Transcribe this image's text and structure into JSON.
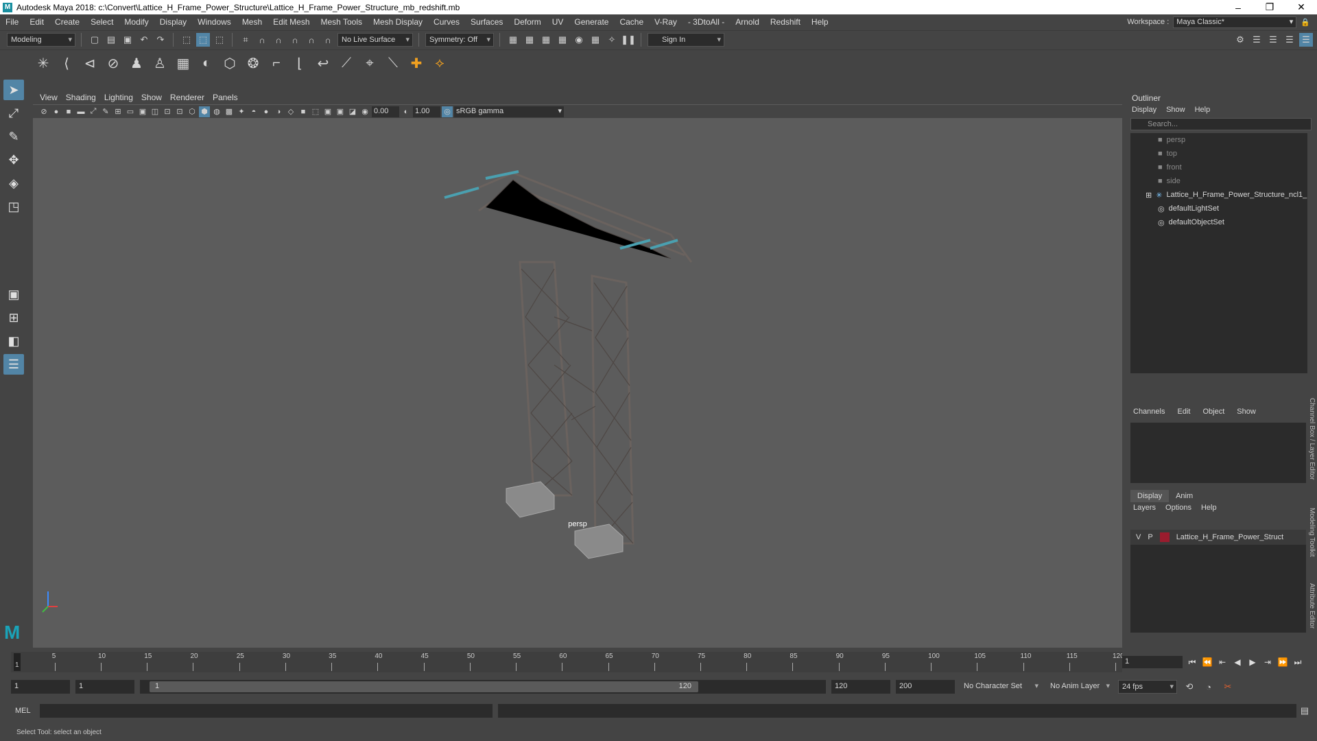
{
  "window": {
    "title": "Autodesk Maya 2018: c:\\Convert\\Lattice_H_Frame_Power_Structure\\Lattice_H_Frame_Power_Structure_mb_redshift.mb",
    "logo": "M",
    "minimize": "–",
    "maximize": "❐",
    "close": "✕"
  },
  "menu": [
    "File",
    "Edit",
    "Create",
    "Select",
    "Modify",
    "Display",
    "Windows",
    "Mesh",
    "Edit Mesh",
    "Mesh Tools",
    "Mesh Display",
    "Curves",
    "Surfaces",
    "Deform",
    "UV",
    "Generate",
    "Cache",
    "V-Ray",
    "- 3DtoAll -",
    "Arnold",
    "Redshift",
    "Help"
  ],
  "workspace": {
    "label": "Workspace :",
    "value": "Maya Classic*"
  },
  "statusline": {
    "mode": "Modeling",
    "live_surface": "No Live Surface",
    "symmetry": "Symmetry: Off",
    "sign_in": "Sign In"
  },
  "viewport": {
    "menus": [
      "View",
      "Shading",
      "Lighting",
      "Show",
      "Renderer",
      "Panels"
    ],
    "exposure": "0.00",
    "gamma": "1.00",
    "color_space": "sRGB gamma",
    "camera_label": "persp"
  },
  "outliner": {
    "title": "Outliner",
    "menus": [
      "Display",
      "Show",
      "Help"
    ],
    "search_placeholder": "Search...",
    "items": [
      {
        "label": "persp",
        "icon": "camera-icon",
        "dim": true
      },
      {
        "label": "top",
        "icon": "camera-icon",
        "dim": true
      },
      {
        "label": "front",
        "icon": "camera-icon",
        "dim": true
      },
      {
        "label": "side",
        "icon": "camera-icon",
        "dim": true
      },
      {
        "label": "Lattice_H_Frame_Power_Structure_ncl1_",
        "icon": "transform-icon",
        "dim": false
      },
      {
        "label": "defaultLightSet",
        "icon": "set-icon",
        "dim": false
      },
      {
        "label": "defaultObjectSet",
        "icon": "set-icon",
        "dim": false
      }
    ]
  },
  "channelbox": {
    "menus": [
      "Channels",
      "Edit",
      "Object",
      "Show"
    ],
    "tabs": [
      "Display",
      "Anim"
    ],
    "layer_menus": [
      "Layers",
      "Options",
      "Help"
    ],
    "layer": {
      "v": "V",
      "p": "P",
      "name": "Lattice_H_Frame_Power_Struct",
      "color": "#9a1c2e"
    },
    "side_tabs": [
      "Channel Box / Layer Editor",
      "Modeling Toolkit",
      "Attribute Editor"
    ]
  },
  "timeline": {
    "ticks": [
      "5",
      "10",
      "15",
      "20",
      "25",
      "30",
      "35",
      "40",
      "45",
      "50",
      "55",
      "60",
      "65",
      "70",
      "75",
      "80",
      "85",
      "90",
      "95",
      "100",
      "105",
      "110",
      "115",
      "120"
    ],
    "start_marker": "1",
    "current_frame": "1"
  },
  "range": {
    "start": "1",
    "playback_start": "1",
    "range_start": "1",
    "range_end": "120",
    "playback_end": "120",
    "end": "200",
    "character_set": "No Character Set",
    "anim_layer": "No Anim Layer",
    "fps": "24 fps"
  },
  "mel": {
    "label": "MEL"
  },
  "help_line": "Select Tool: select an object"
}
